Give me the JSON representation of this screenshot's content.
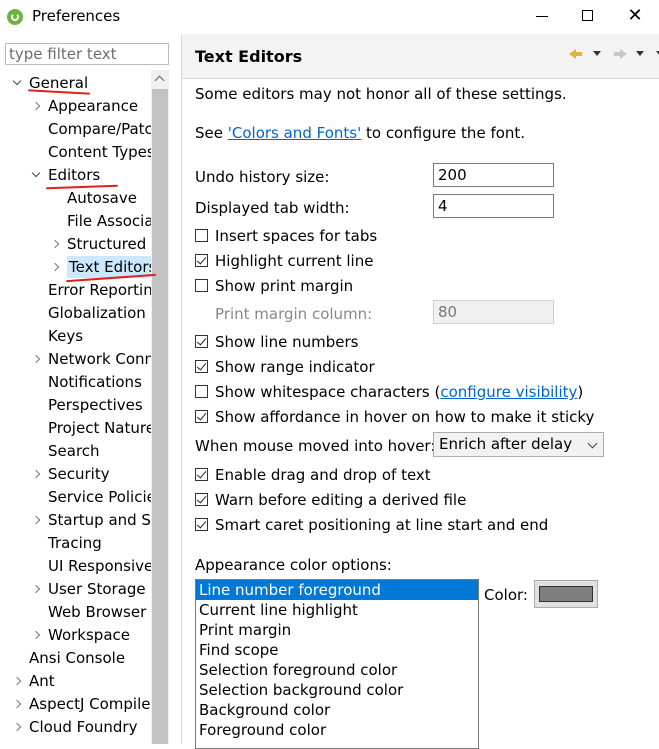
{
  "window": {
    "title": "Preferences"
  },
  "filter": {
    "placeholder": "type filter text"
  },
  "tree": [
    {
      "label": "General",
      "level": 0,
      "twisty": "down"
    },
    {
      "label": "Appearance",
      "level": 1,
      "twisty": "right"
    },
    {
      "label": "Compare/Patch",
      "level": 1,
      "twisty": "none"
    },
    {
      "label": "Content Types",
      "level": 1,
      "twisty": "none"
    },
    {
      "label": "Editors",
      "level": 1,
      "twisty": "down"
    },
    {
      "label": "Autosave",
      "level": 2,
      "twisty": "none"
    },
    {
      "label": "File Associations",
      "level": 2,
      "twisty": "none"
    },
    {
      "label": "Structured",
      "level": 2,
      "twisty": "right"
    },
    {
      "label": "Text Editors",
      "level": 2,
      "twisty": "right",
      "selected": true
    },
    {
      "label": "Error Reporting",
      "level": 1,
      "twisty": "none"
    },
    {
      "label": "Globalization",
      "level": 1,
      "twisty": "none"
    },
    {
      "label": "Keys",
      "level": 1,
      "twisty": "none"
    },
    {
      "label": "Network Connections",
      "level": 1,
      "twisty": "right"
    },
    {
      "label": "Notifications",
      "level": 1,
      "twisty": "none"
    },
    {
      "label": "Perspectives",
      "level": 1,
      "twisty": "none"
    },
    {
      "label": "Project Natures",
      "level": 1,
      "twisty": "none"
    },
    {
      "label": "Search",
      "level": 1,
      "twisty": "none"
    },
    {
      "label": "Security",
      "level": 1,
      "twisty": "right"
    },
    {
      "label": "Service Policies",
      "level": 1,
      "twisty": "none"
    },
    {
      "label": "Startup and Shutdown",
      "level": 1,
      "twisty": "right"
    },
    {
      "label": "Tracing",
      "level": 1,
      "twisty": "none"
    },
    {
      "label": "UI Responsiveness",
      "level": 1,
      "twisty": "none"
    },
    {
      "label": "User Storage Service",
      "level": 1,
      "twisty": "right"
    },
    {
      "label": "Web Browser",
      "level": 1,
      "twisty": "none"
    },
    {
      "label": "Workspace",
      "level": 1,
      "twisty": "right"
    },
    {
      "label": "Ansi Console",
      "level": 0,
      "twisty": "none"
    },
    {
      "label": "Ant",
      "level": 0,
      "twisty": "right"
    },
    {
      "label": "AspectJ Compiler",
      "level": 0,
      "twisty": "right"
    },
    {
      "label": "Cloud Foundry",
      "level": 0,
      "twisty": "right"
    }
  ],
  "page": {
    "title": "Text Editors",
    "note": "Some editors may not honor all of these settings.",
    "see_prefix": "See ",
    "colors_link": "'Colors and Fonts'",
    "see_suffix": " to configure the font.",
    "undo_label": "Undo history size:",
    "undo_value": "200",
    "tab_label": "Displayed tab width:",
    "tab_value": "4",
    "checks": {
      "insert_spaces": {
        "label": "Insert spaces for tabs",
        "checked": false
      },
      "highlight_line": {
        "label": "Highlight current line",
        "checked": true
      },
      "print_margin": {
        "label": "Show print margin",
        "checked": false
      },
      "line_numbers": {
        "label": "Show line numbers",
        "checked": true
      },
      "range_indicator": {
        "label": "Show range indicator",
        "checked": true
      },
      "whitespace": {
        "label": "Show whitespace characters (",
        "checked": false
      },
      "affordance": {
        "label": "Show affordance in hover on how to make it sticky",
        "checked": true
      },
      "drag_drop": {
        "label": "Enable drag and drop of text",
        "checked": true
      },
      "warn_derived": {
        "label": "Warn before editing a derived file",
        "checked": true
      },
      "smart_caret": {
        "label": "Smart caret positioning at line start and end",
        "checked": true
      }
    },
    "whitespace_link": "configure visibility",
    "whitespace_close": ")",
    "print_margin_col_label": "Print margin column:",
    "print_margin_col_value": "80",
    "hover_label": "When mouse moved into hover:",
    "hover_value": "Enrich after delay",
    "appearance_label": "Appearance color options:",
    "color_label": "Color:",
    "color_value": "#7f7f7f",
    "color_options": [
      "Line number foreground",
      "Current line highlight",
      "Print margin",
      "Find scope",
      "Selection foreground color",
      "Selection background color",
      "Background color",
      "Foreground color"
    ]
  },
  "colors": {
    "selection": "#0078d7",
    "link": "#0066cc",
    "annotation": "#e0201a"
  }
}
